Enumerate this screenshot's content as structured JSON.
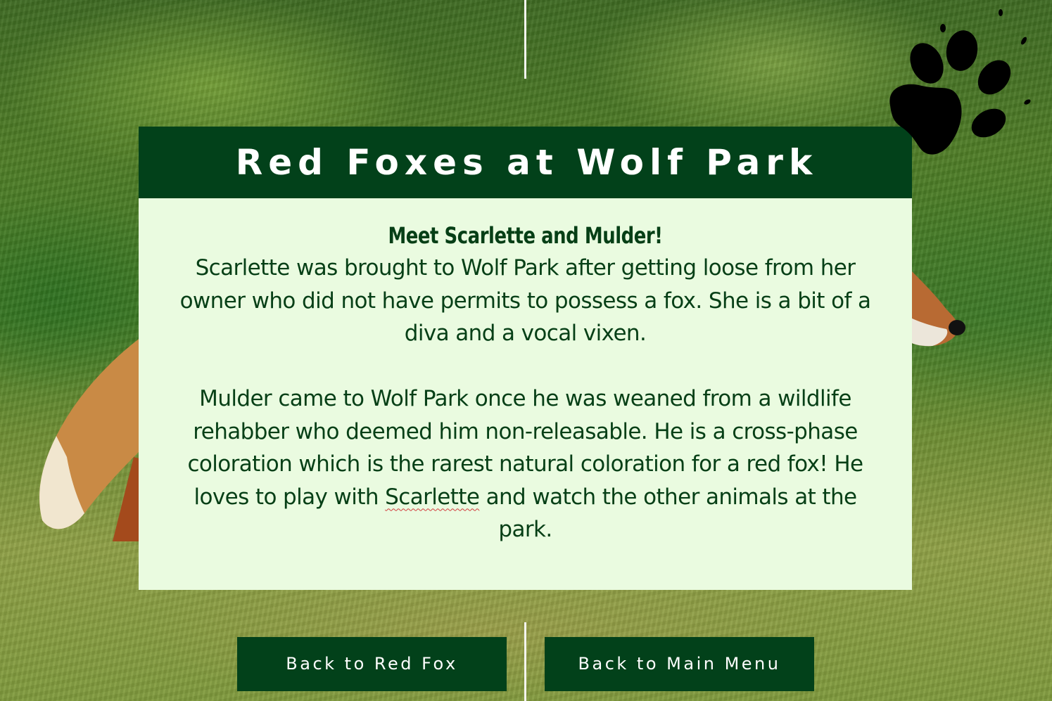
{
  "page": {
    "title": "Red Foxes at Wolf Park"
  },
  "card": {
    "heading": "Meet Scarlette and Mulder!",
    "paragraph_1": "Scarlette was brought to Wolf Park after getting loose from her owner who did not have permits to possess a fox. She is a bit of a diva and a vocal vixen.",
    "paragraph_2_before": "Mulder came to Wolf Park once he was weaned from a wildlife rehabber who deemed him non-releasable. He is a cross-phase coloration which is the rarest natural coloration for a red fox! He loves to play with ",
    "paragraph_2_spell": "Scarlette",
    "paragraph_2_after": " and watch the other animals at the park."
  },
  "buttons": {
    "back_to_red_fox": "Back to Red Fox",
    "back_to_main_menu": "Back to Main Menu"
  },
  "icons": {
    "paw": "paw-print-icon"
  },
  "colors": {
    "header_bg": "#02411a",
    "card_bg": "#eafbe0",
    "text": "#063f16"
  }
}
